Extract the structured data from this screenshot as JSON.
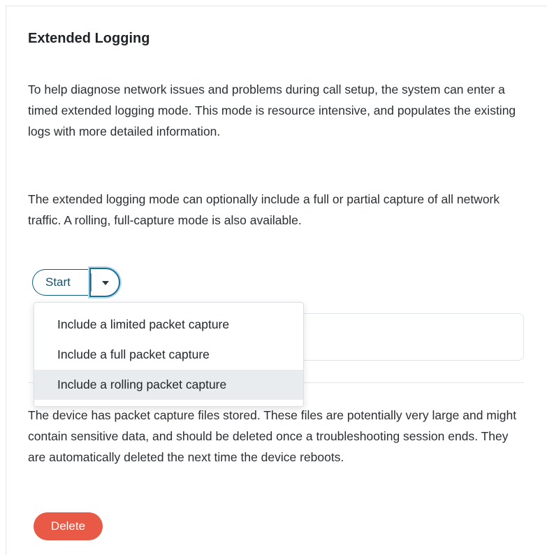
{
  "panel": {
    "title": "Extended Logging",
    "paragraph_1": "To help diagnose network issues and problems during call setup, the system can enter a timed extended logging mode. This mode is resource intensive, and populates the existing logs with more detailed information.",
    "paragraph_2": "The extended logging mode can optionally include a full or partial capture of all network traffic. A rolling, full-capture mode is also available.",
    "paragraph_3": "The device has packet capture files stored. These files are potentially very large and might contain sensitive data, and should be deleted once a troubleshooting session ends. They are automatically deleted the next time the device reboots."
  },
  "split_button": {
    "start_label": "Start",
    "caret_icon": "chevron-down-icon"
  },
  "dropdown": {
    "items": [
      {
        "label": "Include a limited packet capture"
      },
      {
        "label": "Include a full packet capture"
      },
      {
        "label": "Include a rolling packet capture",
        "highlighted": true
      }
    ]
  },
  "actions": {
    "delete_label": "Delete"
  },
  "colors": {
    "accent": "#1a6f93",
    "danger": "#e85a45",
    "menu_highlight": "#e9ecef"
  }
}
